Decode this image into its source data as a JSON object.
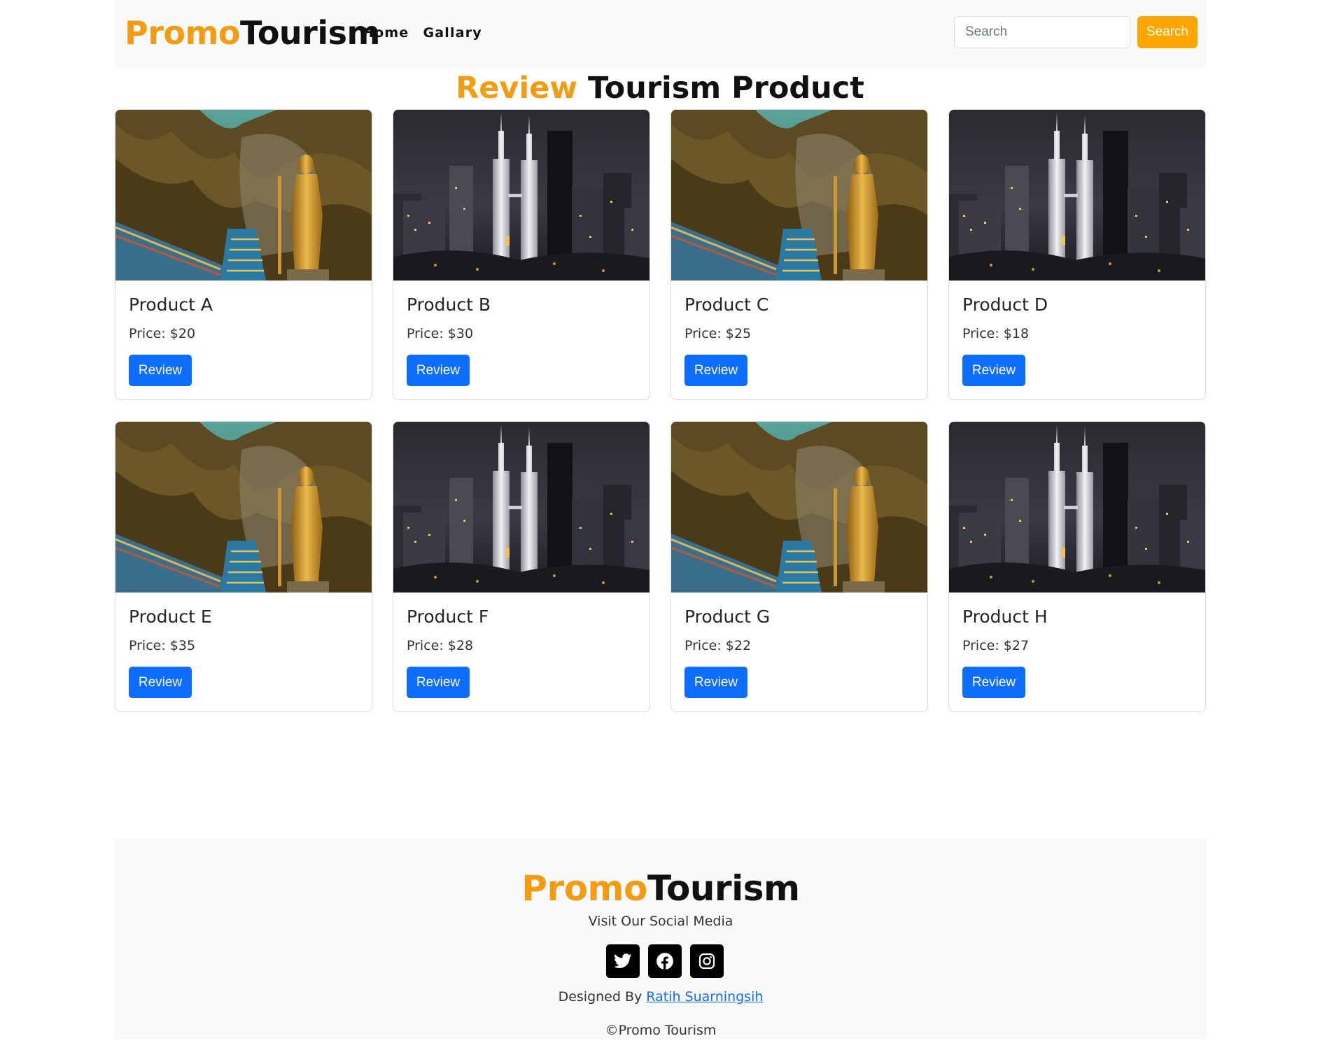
{
  "brand": {
    "part1": "Promo",
    "part2": "Tourism"
  },
  "nav": {
    "items": [
      {
        "label": "Home"
      },
      {
        "label": "Gallary"
      }
    ]
  },
  "search": {
    "placeholder": "Search",
    "button_label": "Search"
  },
  "heading": {
    "accent": "Review",
    "rest": " Tourism Product"
  },
  "products": [
    {
      "name": "Product A",
      "price": "Price: $20",
      "button": "Review",
      "image": "temple-statue"
    },
    {
      "name": "Product B",
      "price": "Price: $30",
      "button": "Review",
      "image": "city-skyline"
    },
    {
      "name": "Product C",
      "price": "Price: $25",
      "button": "Review",
      "image": "temple-statue"
    },
    {
      "name": "Product D",
      "price": "Price: $18",
      "button": "Review",
      "image": "city-skyline"
    },
    {
      "name": "Product E",
      "price": "Price: $35",
      "button": "Review",
      "image": "temple-statue"
    },
    {
      "name": "Product F",
      "price": "Price: $28",
      "button": "Review",
      "image": "city-skyline"
    },
    {
      "name": "Product G",
      "price": "Price: $22",
      "button": "Review",
      "image": "temple-statue"
    },
    {
      "name": "Product H",
      "price": "Price: $27",
      "button": "Review",
      "image": "city-skyline"
    }
  ],
  "footer": {
    "brand_part1": "Promo",
    "brand_part2": "Tourism",
    "social_label": "Visit Our Social Media",
    "socials": [
      {
        "icon": "twitter-icon"
      },
      {
        "icon": "facebook-icon"
      },
      {
        "icon": "instagram-icon"
      }
    ],
    "designed_prefix": "Designed By ",
    "designer": "Ratih Suarningsih",
    "copyright": "©Promo Tourism"
  },
  "colors": {
    "accent": "#f39c12",
    "search_button": "#ffa500",
    "primary": "#0d6efd",
    "navbar_bg": "#f8f9fa"
  }
}
